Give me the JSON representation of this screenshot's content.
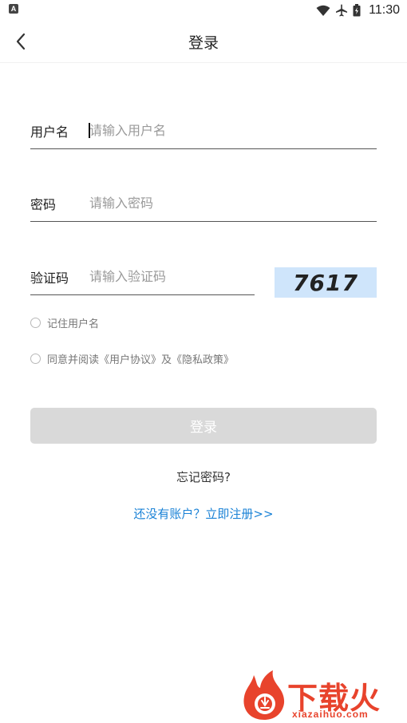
{
  "status_bar": {
    "left_icon_letter": "A",
    "time": "11:30",
    "icons": [
      "wifi-icon",
      "airplane-icon",
      "battery-icon"
    ]
  },
  "header": {
    "title": "登录",
    "back_icon": "chevron-left-icon"
  },
  "form": {
    "username": {
      "label": "用户名",
      "placeholder": "请输入用户名",
      "value": ""
    },
    "password": {
      "label": "密码",
      "placeholder": "请输入密码",
      "value": ""
    },
    "captcha": {
      "label": "验证码",
      "placeholder": "请输入验证码",
      "value": "",
      "image_text": "7617"
    },
    "remember_label": "记住用户名",
    "agree_label": "同意并阅读《用户协议》及《隐私政策》",
    "login_button": "登录",
    "forgot_link": "忘记密码?",
    "register_link": "还没有账户？立即注册>>"
  },
  "watermark": {
    "brand": "下载火",
    "domain": "xiazaihuo.com"
  },
  "colors": {
    "accent_link": "#1a82d6",
    "button_disabled": "#d9d9d9",
    "captcha_bg": "#cfe5fb",
    "watermark": "#e8432c"
  }
}
